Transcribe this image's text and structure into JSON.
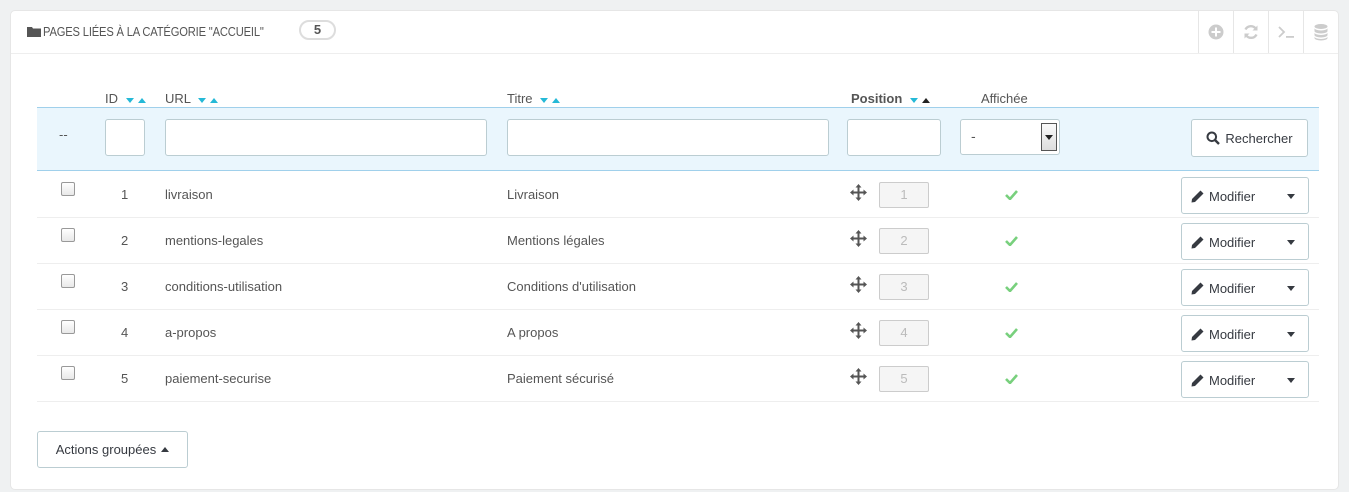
{
  "panel": {
    "title": "PAGES LIÉES À LA CATÉGORIE \"ACCUEIL\"",
    "count": "5"
  },
  "toolbar": {
    "icons": [
      "add-icon",
      "refresh-icon",
      "sql-query-icon",
      "database-icon"
    ]
  },
  "columns": {
    "id": "ID",
    "url": "URL",
    "title": "Titre",
    "position": "Position",
    "displayed": "Affichée"
  },
  "filters": {
    "dash": "--",
    "displayed_select_value": "-",
    "search_label": "Rechercher"
  },
  "rows": [
    {
      "id": "1",
      "url": "livraison",
      "title": "Livraison",
      "position": "1",
      "displayed": true,
      "action": "Modifier"
    },
    {
      "id": "2",
      "url": "mentions-legales",
      "title": "Mentions légales",
      "position": "2",
      "displayed": true,
      "action": "Modifier"
    },
    {
      "id": "3",
      "url": "conditions-utilisation",
      "title": "Conditions d'utilisation",
      "position": "3",
      "displayed": true,
      "action": "Modifier"
    },
    {
      "id": "4",
      "url": "a-propos",
      "title": "A propos",
      "position": "4",
      "displayed": true,
      "action": "Modifier"
    },
    {
      "id": "5",
      "url": "paiement-securise",
      "title": "Paiement sécurisé",
      "position": "5",
      "displayed": true,
      "action": "Modifier"
    }
  ],
  "bulk_actions": "Actions groupées",
  "colors": {
    "accent": "#25b9d7",
    "check_green": "#78d07d",
    "filter_bg": "#eaf6fd"
  }
}
